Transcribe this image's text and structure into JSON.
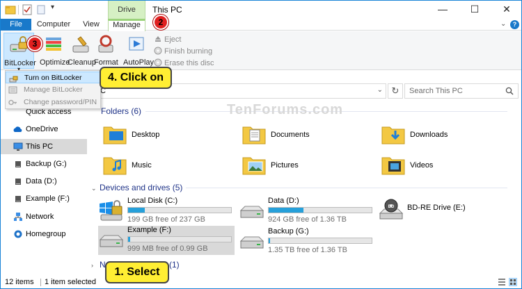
{
  "window": {
    "title": "This PC",
    "context_tab_header": "Drive Tools",
    "controls": {
      "minimize": "—",
      "maximize": "☐",
      "close": "✕"
    }
  },
  "tabs": [
    {
      "label": "File"
    },
    {
      "label": "Computer"
    },
    {
      "label": "View"
    },
    {
      "label": "Manage"
    }
  ],
  "ribbon": {
    "bitlocker": "BitLocker",
    "optimize": "Optimize",
    "cleanup": "Cleanup",
    "format": "Format",
    "autoplay": "AutoPlay",
    "eject": "Eject",
    "finish_burning": "Finish burning",
    "erase_disc": "Erase this disc"
  },
  "dropdown": {
    "items": [
      {
        "label": "Turn on BitLocker"
      },
      {
        "label": "Manage BitLocker"
      },
      {
        "label": "Change password/PIN"
      }
    ]
  },
  "address": {
    "path": "C"
  },
  "search": {
    "placeholder": "Search This PC"
  },
  "nav": {
    "items": [
      {
        "label": "Quick access"
      },
      {
        "label": "OneDrive"
      },
      {
        "label": "This PC"
      },
      {
        "label": "Backup (G:)"
      },
      {
        "label": "Data (D:)"
      },
      {
        "label": "Example (F:)"
      },
      {
        "label": "Network"
      },
      {
        "label": "Homegroup"
      }
    ]
  },
  "folders": {
    "header": "Folders (6)",
    "items": [
      {
        "label": "Desktop"
      },
      {
        "label": "Documents"
      },
      {
        "label": "Downloads"
      },
      {
        "label": "Music"
      },
      {
        "label": "Pictures"
      },
      {
        "label": "Videos"
      }
    ]
  },
  "devices": {
    "header": "Devices and drives (5)",
    "items": [
      {
        "name": "Local Disk (C:)",
        "free": "199 GB free of 237 GB",
        "used_fraction": 0.16
      },
      {
        "name": "Data (D:)",
        "free": "924 GB free of 1.36 TB",
        "used_fraction": 0.34
      },
      {
        "name": "BD-RE Drive (E:)",
        "free": "",
        "used_fraction": 0
      },
      {
        "name": "Example (F:)",
        "free": "999 MB free of 0.99 GB",
        "used_fraction": 0.02
      },
      {
        "name": "Backup (G:)",
        "free": "1.35 TB free of 1.36 TB",
        "used_fraction": 0.01
      }
    ]
  },
  "network_group": {
    "prefix": "N",
    "suffix": "(1)"
  },
  "status": {
    "count": "12 items",
    "selected": "1 item selected"
  },
  "annotations": {
    "b2": "2",
    "b3": "3",
    "click_on": "4. Click on",
    "select": "1. Select"
  },
  "watermark": "TenForums.com",
  "colors": {
    "accent": "#1979ca",
    "drive_bar": "#26a0da",
    "callout": "#ffee33",
    "badge": "#e02020"
  }
}
